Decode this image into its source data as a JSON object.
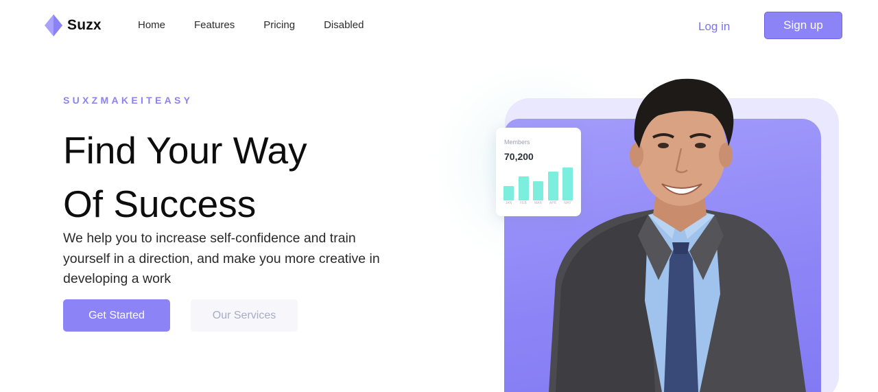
{
  "nav": {
    "brand": "Suzx",
    "links": [
      "Home",
      "Features",
      "Pricing",
      "Disabled"
    ],
    "login": "Log in",
    "signup": "Sign up"
  },
  "hero": {
    "eyebrow": "SUXZMAKEITEASY",
    "title_line1": "Find Your Way",
    "title_line2": "Of Success",
    "description": "We help you to increase self-confidence and train yourself in a direction, and make you more creative in developing a work",
    "primary_button": "Get Started",
    "secondary_button": "Our Services"
  },
  "stat_card": {
    "label": "Members",
    "value": "70,200",
    "months": [
      "JAN",
      "FEB",
      "MAR",
      "APR",
      "MAY"
    ],
    "bar_levels": [
      0.42,
      0.7,
      0.56,
      0.84,
      0.96
    ]
  },
  "colors": {
    "accent": "#8b83f6",
    "accent_border": "#6e64e8",
    "login_text": "#7b72f0",
    "bar": "#7deedd",
    "panel_light": "#e9e8ff"
  },
  "icons": {
    "brand": "diamond-logo-icon"
  }
}
